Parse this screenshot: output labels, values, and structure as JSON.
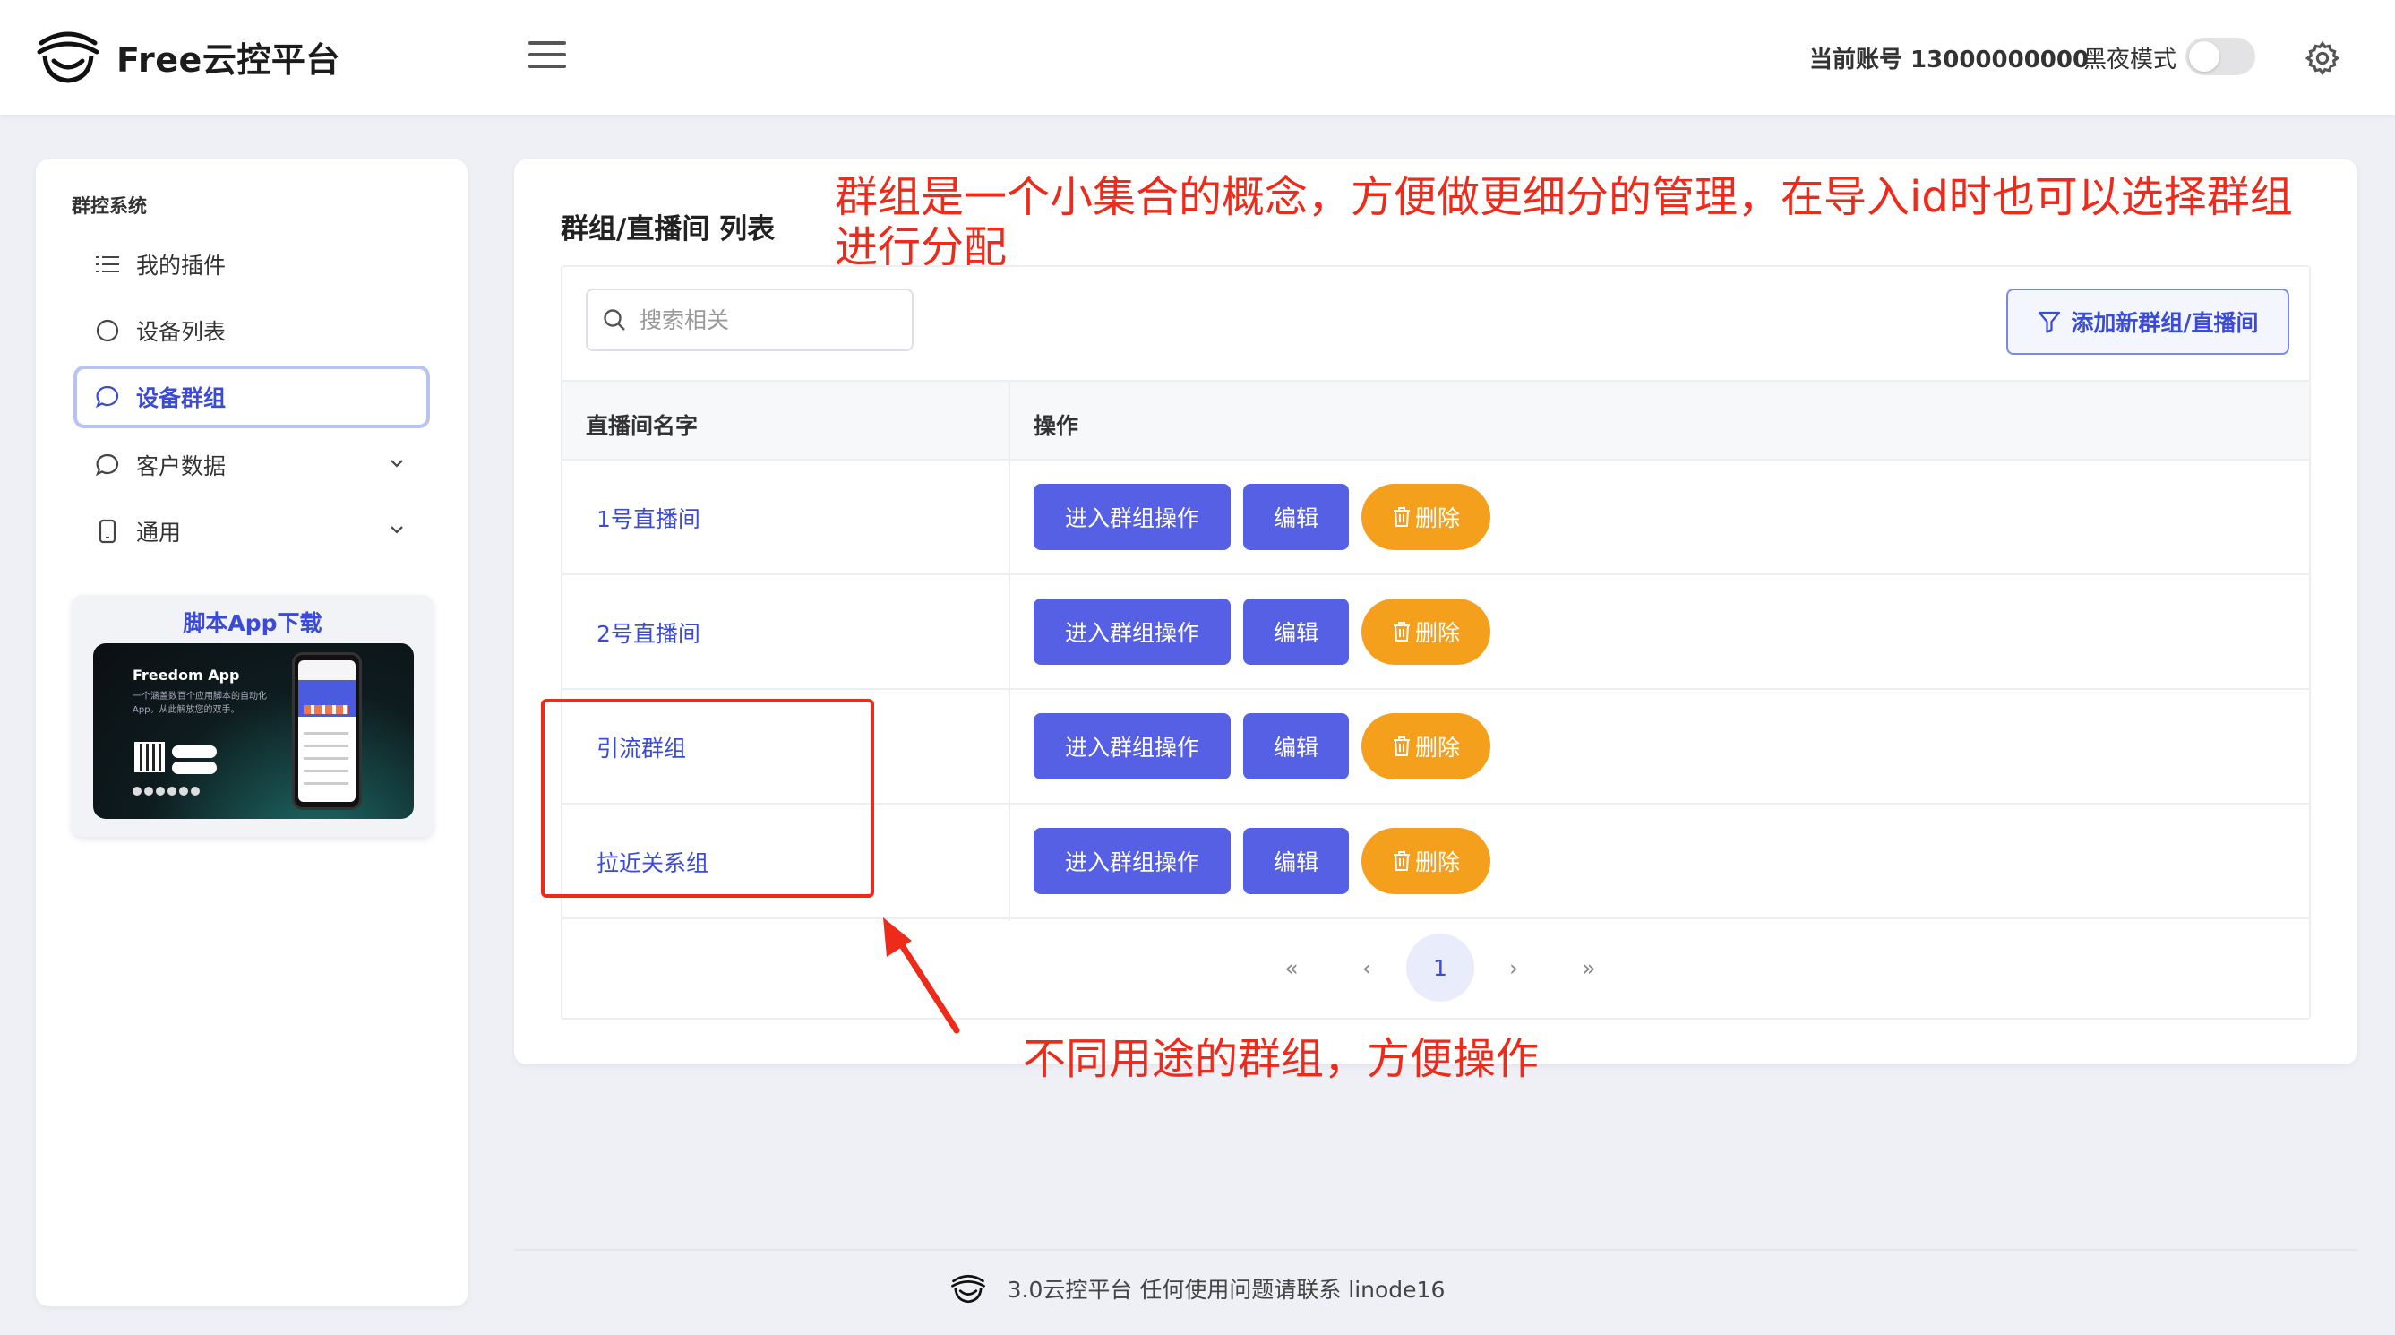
{
  "header": {
    "brand": "Free云控平台",
    "account_label": "当前账号 13000000000",
    "dark_mode_label": "黑夜模式"
  },
  "sidebar": {
    "section_title": "群控系统",
    "items": [
      {
        "label": "我的插件",
        "icon": "list-icon"
      },
      {
        "label": "设备列表",
        "icon": "circle-icon"
      },
      {
        "label": "设备群组",
        "icon": "chat-icon",
        "active": true
      },
      {
        "label": "客户数据",
        "icon": "chat-icon",
        "expandable": true
      },
      {
        "label": "通用",
        "icon": "phone-icon",
        "expandable": true
      }
    ],
    "app_card": {
      "title": "脚本App下载",
      "banner_title": "Freedom App",
      "banner_subtitle": "一个涵盖数百个应用脚本的自动化App，从此解放您的双手。"
    }
  },
  "main": {
    "title": "群组/直播间 列表",
    "annotation_top": "群组是一个小集合的概念，方便做更细分的管理，在导入id时也可以选择群组进行分配",
    "search_placeholder": "搜索相关",
    "add_button": "添加新群组/直播间",
    "columns": [
      "直播间名字",
      "操作"
    ],
    "rows": [
      {
        "name": "1号直播间"
      },
      {
        "name": "2号直播间"
      },
      {
        "name": "引流群组"
      },
      {
        "name": "拉近关系组"
      }
    ],
    "actions": {
      "enter": "进入群组操作",
      "edit": "编辑",
      "delete": "删除"
    },
    "pagination": {
      "first": "«",
      "prev": "‹",
      "current": "1",
      "next": "›",
      "last": "»"
    },
    "annotation_bottom": "不同用途的群组，方便操作"
  },
  "footer": {
    "text": "3.0云控平台 任何使用问题请联系 linode16"
  },
  "colors": {
    "primary": "#5660e5",
    "link": "#3b4bd8",
    "danger_btn": "#f5a01c",
    "annotation": "#ee2a1a"
  }
}
